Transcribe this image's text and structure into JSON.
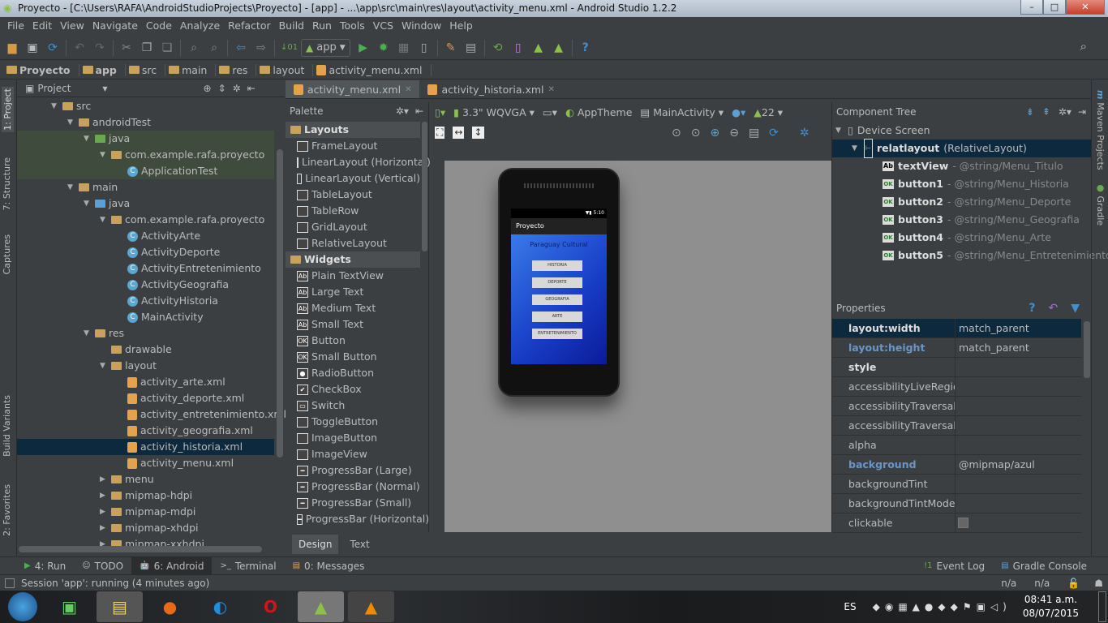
{
  "window": {
    "title": "Proyecto - [C:\\Users\\RAFA\\AndroidStudioProjects\\Proyecto] - [app] - ...\\app\\src\\main\\res\\layout\\activity_menu.xml - Android Studio 1.2.2",
    "minimize": "–",
    "maximize": "□",
    "close": "✕"
  },
  "menu": [
    "File",
    "Edit",
    "View",
    "Navigate",
    "Code",
    "Analyze",
    "Refactor",
    "Build",
    "Run",
    "Tools",
    "VCS",
    "Window",
    "Help"
  ],
  "toolbar": {
    "run_config": "app"
  },
  "breadcrumb": [
    "Proyecto",
    "app",
    "src",
    "main",
    "res",
    "layout",
    "activity_menu.xml"
  ],
  "left_stripe": [
    "1: Project",
    "7: Structure",
    "Captures",
    "Build Variants",
    "2: Favorites"
  ],
  "right_stripe": [
    "Maven Projects",
    "Gradle"
  ],
  "project": {
    "view": "Project",
    "tree": [
      {
        "label": "src",
        "depth": 2,
        "icon": "folder",
        "open": true
      },
      {
        "label": "androidTest",
        "depth": 3,
        "icon": "folder",
        "open": true
      },
      {
        "label": "java",
        "depth": 4,
        "icon": "folder-green",
        "open": true,
        "hl": true
      },
      {
        "label": "com.example.rafa.proyecto",
        "depth": 5,
        "icon": "package",
        "open": true,
        "hl": true
      },
      {
        "label": "ApplicationTest",
        "depth": 6,
        "icon": "class",
        "hl": true
      },
      {
        "label": "main",
        "depth": 3,
        "icon": "folder",
        "open": true
      },
      {
        "label": "java",
        "depth": 4,
        "icon": "folder-blue",
        "open": true
      },
      {
        "label": "com.example.rafa.proyecto",
        "depth": 5,
        "icon": "package",
        "open": true
      },
      {
        "label": "ActivityArte",
        "depth": 6,
        "icon": "class"
      },
      {
        "label": "ActivityDeporte",
        "depth": 6,
        "icon": "class"
      },
      {
        "label": "ActivityEntretenimiento",
        "depth": 6,
        "icon": "class"
      },
      {
        "label": "ActivityGeografia",
        "depth": 6,
        "icon": "class"
      },
      {
        "label": "ActivityHistoria",
        "depth": 6,
        "icon": "class"
      },
      {
        "label": "MainActivity",
        "depth": 6,
        "icon": "class"
      },
      {
        "label": "res",
        "depth": 4,
        "icon": "folder-res",
        "open": true
      },
      {
        "label": "drawable",
        "depth": 5,
        "icon": "folder"
      },
      {
        "label": "layout",
        "depth": 5,
        "icon": "folder",
        "open": true
      },
      {
        "label": "activity_arte.xml",
        "depth": 6,
        "icon": "xml"
      },
      {
        "label": "activity_deporte.xml",
        "depth": 6,
        "icon": "xml"
      },
      {
        "label": "activity_entretenimiento.xml",
        "depth": 6,
        "icon": "xml"
      },
      {
        "label": "activity_geografia.xml",
        "depth": 6,
        "icon": "xml"
      },
      {
        "label": "activity_historia.xml",
        "depth": 6,
        "icon": "xml",
        "selected": true
      },
      {
        "label": "activity_menu.xml",
        "depth": 6,
        "icon": "xml"
      },
      {
        "label": "menu",
        "depth": 5,
        "icon": "folder",
        "closed": true
      },
      {
        "label": "mipmap-hdpi",
        "depth": 5,
        "icon": "folder",
        "closed": true
      },
      {
        "label": "mipmap-mdpi",
        "depth": 5,
        "icon": "folder",
        "closed": true
      },
      {
        "label": "mipmap-xhdpi",
        "depth": 5,
        "icon": "folder",
        "closed": true
      },
      {
        "label": "mipmap-xxhdpi",
        "depth": 5,
        "icon": "folder",
        "closed": true
      }
    ]
  },
  "editor_tabs": [
    {
      "label": "activity_menu.xml",
      "active": true
    },
    {
      "label": "activity_historia.xml"
    }
  ],
  "palette": {
    "title": "Palette",
    "items": [
      {
        "label": "Layouts",
        "cat": true
      },
      {
        "label": "FrameLayout",
        "ic": ""
      },
      {
        "label": "LinearLayout (Horizontal)",
        "ic": ""
      },
      {
        "label": "LinearLayout (Vertical)",
        "ic": ""
      },
      {
        "label": "TableLayout",
        "ic": ""
      },
      {
        "label": "TableRow",
        "ic": ""
      },
      {
        "label": "GridLayout",
        "ic": ""
      },
      {
        "label": "RelativeLayout",
        "ic": ""
      },
      {
        "label": "Widgets",
        "cat": true
      },
      {
        "label": "Plain TextView",
        "ic": "Ab"
      },
      {
        "label": "Large Text",
        "ic": "Ab"
      },
      {
        "label": "Medium Text",
        "ic": "Ab"
      },
      {
        "label": "Small Text",
        "ic": "Ab"
      },
      {
        "label": "Button",
        "ic": "OK"
      },
      {
        "label": "Small Button",
        "ic": "OK"
      },
      {
        "label": "RadioButton",
        "ic": "●"
      },
      {
        "label": "CheckBox",
        "ic": "✔"
      },
      {
        "label": "Switch",
        "ic": "▭"
      },
      {
        "label": "ToggleButton",
        "ic": ""
      },
      {
        "label": "ImageButton",
        "ic": ""
      },
      {
        "label": "ImageView",
        "ic": ""
      },
      {
        "label": "ProgressBar (Large)",
        "ic": "━"
      },
      {
        "label": "ProgressBar (Normal)",
        "ic": "━"
      },
      {
        "label": "ProgressBar (Small)",
        "ic": "━"
      },
      {
        "label": "ProgressBar (Horizontal)",
        "ic": "━"
      }
    ]
  },
  "design_toolbar": {
    "device": "3.3\" WQVGA",
    "theme": "AppTheme",
    "activity": "MainActivity",
    "api": "22"
  },
  "phone": {
    "status_time": "5:10",
    "app_title": "Proyecto",
    "heading": "Paraguay Cultural",
    "buttons": [
      "HISTORIA",
      "DEPORTE",
      "GEOGRAFIA",
      "ARTE",
      "ENTRETENIMIENTO"
    ]
  },
  "component_tree": {
    "title": "Component Tree",
    "root": "Device Screen",
    "layout_id": "relatlayout",
    "layout_type": "(RelativeLayout)",
    "children": [
      {
        "id": "textView",
        "ref": "- @string/Menu_Titulo",
        "ic": "Ab"
      },
      {
        "id": "button1",
        "ref": "- @string/Menu_Historia",
        "ic": "OK"
      },
      {
        "id": "button2",
        "ref": "- @string/Menu_Deporte",
        "ic": "OK"
      },
      {
        "id": "button3",
        "ref": "- @string/Menu_Geografia",
        "ic": "OK"
      },
      {
        "id": "button4",
        "ref": "- @string/Menu_Arte",
        "ic": "OK"
      },
      {
        "id": "button5",
        "ref": "- @string/Menu_Entretenimiento",
        "ic": "OK"
      }
    ]
  },
  "properties": {
    "title": "Properties",
    "rows": [
      {
        "k": "layout:width",
        "v": "match_parent",
        "style": "bold",
        "selected": true
      },
      {
        "k": "layout:height",
        "v": "match_parent",
        "style": "blue"
      },
      {
        "k": "style",
        "v": "",
        "style": "bold"
      },
      {
        "k": "accessibilityLiveRegion",
        "v": ""
      },
      {
        "k": "accessibilityTraversalAfter",
        "v": ""
      },
      {
        "k": "accessibilityTraversalBefore",
        "v": ""
      },
      {
        "k": "alpha",
        "v": ""
      },
      {
        "k": "background",
        "v": "@mipmap/azul",
        "style": "blue"
      },
      {
        "k": "backgroundTint",
        "v": ""
      },
      {
        "k": "backgroundTintMode",
        "v": ""
      },
      {
        "k": "clickable",
        "v": "",
        "checkbox": true
      }
    ]
  },
  "design_tabs": [
    "Design",
    "Text"
  ],
  "bottom_tools": [
    {
      "label": "4: Run",
      "ic": "▶"
    },
    {
      "label": "TODO",
      "ic": "☺"
    },
    {
      "label": "6: Android",
      "ic": "🤖",
      "active": true
    },
    {
      "label": "Terminal",
      "ic": ">_"
    },
    {
      "label": "0: Messages",
      "ic": "▤"
    }
  ],
  "bottom_right_tools": [
    {
      "label": "Event Log",
      "ic": "!1"
    },
    {
      "label": "Gradle Console",
      "ic": "▤"
    }
  ],
  "status": {
    "text": "Session 'app': running (4 minutes ago)",
    "pos1": "n/a",
    "pos2": "n/a"
  },
  "taskbar": {
    "apps": [
      "windows-start",
      "system-monitor",
      "file-explorer",
      "firefox",
      "ccleaner",
      "opera",
      "android-studio",
      "vlc"
    ],
    "lang": "ES",
    "time": "08:41 a.m.",
    "date": "08/07/2015"
  },
  "colors": {
    "bg": "#3c3f41",
    "selection": "#0d293e",
    "highlight": "#3f4b3c",
    "canvas": "#8f8f8f",
    "phone_screen": "#1f4fd0"
  }
}
